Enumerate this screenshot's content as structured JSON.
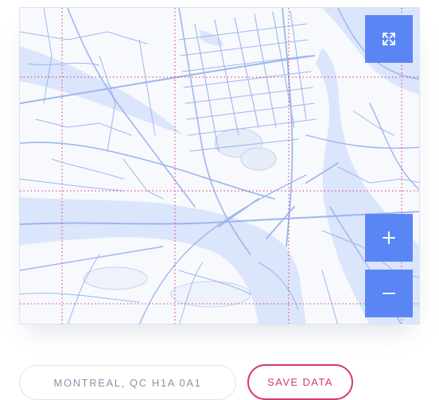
{
  "map": {
    "description": "Street map of Montreal in light blue monochrome style with a dotted red grid overlay",
    "colors": {
      "background": "#f7f9fd",
      "water": "#dbe5fb",
      "road": "#9db6ef",
      "grid": "#d6306e",
      "button": "#5a86f5"
    },
    "controls": {
      "fullscreen_icon": "expand-icon",
      "zoom_in_label": "+",
      "zoom_out_label": "−"
    }
  },
  "location": {
    "label": "MONTREAL, QC H1A 0A1"
  },
  "actions": {
    "save_label": "SAVE DATA"
  }
}
